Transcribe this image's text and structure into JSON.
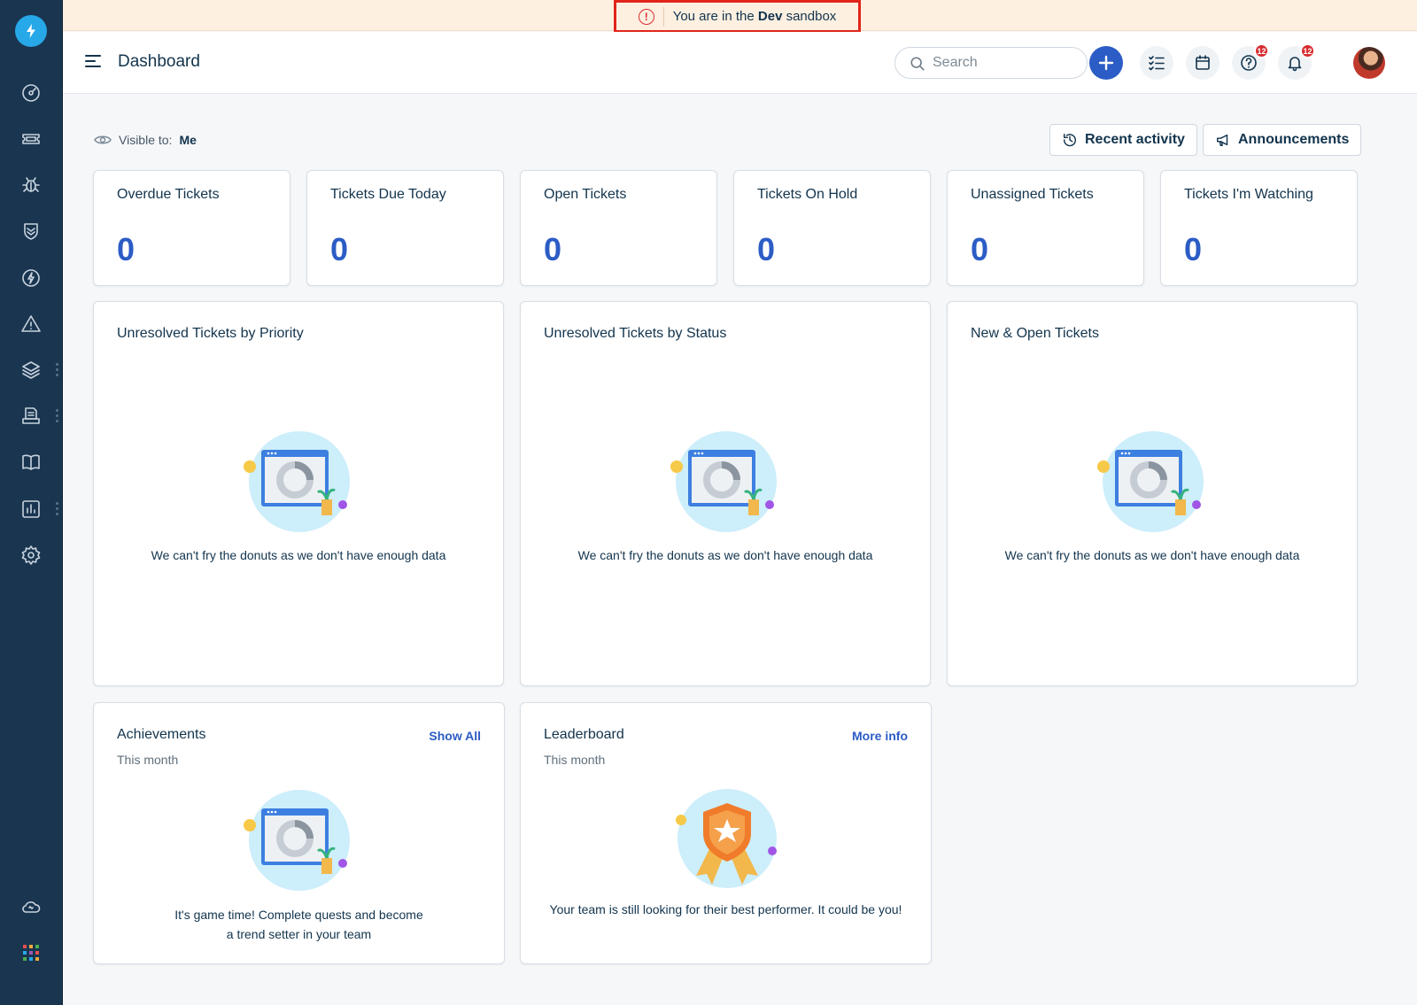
{
  "sandbox": {
    "prefix": "You are in the ",
    "env": "Dev",
    "suffix": " sandbox"
  },
  "header": {
    "title": "Dashboard",
    "search_placeholder": "Search",
    "help_badge": "12",
    "notifications_badge": "12"
  },
  "visibility": {
    "label": "Visible to:",
    "value": "Me"
  },
  "buttons": {
    "recent_activity": "Recent activity",
    "announcements": "Announcements"
  },
  "stats": [
    {
      "label": "Overdue Tickets",
      "value": "0"
    },
    {
      "label": "Tickets Due Today",
      "value": "0"
    },
    {
      "label": "Open Tickets",
      "value": "0"
    },
    {
      "label": "Tickets On Hold",
      "value": "0"
    },
    {
      "label": "Unassigned Tickets",
      "value": "0"
    },
    {
      "label": "Tickets I'm Watching",
      "value": "0"
    }
  ],
  "widgets": [
    {
      "title": "Unresolved Tickets by Priority",
      "empty": "We can't fry the donuts as we don't have enough data"
    },
    {
      "title": "Unresolved Tickets by Status",
      "empty": "We can't fry the donuts as we don't have enough data"
    },
    {
      "title": "New & Open Tickets",
      "empty": "We can't fry the donuts as we don't have enough data"
    }
  ],
  "achievements": {
    "title": "Achievements",
    "subtitle": "This month",
    "link": "Show All",
    "empty_line1": "It's game time! Complete quests and become",
    "empty_line2": "a trend setter in your team"
  },
  "leaderboard": {
    "title": "Leaderboard",
    "subtitle": "This month",
    "link": "More info",
    "empty": "Your team is still looking for their best performer. It could be you!"
  },
  "sidebar": {
    "items": [
      "dashboard-icon",
      "tickets-icon",
      "problems-icon",
      "changes-icon",
      "releases-icon",
      "alerts-icon",
      "assets-icon",
      "contracts-icon",
      "solutions-icon",
      "reports-icon",
      "admin-icon",
      "phone-cloud-icon",
      "apps-grid-icon"
    ]
  },
  "colors": {
    "sidebar": "#1a3550",
    "accent": "#2c5cc5",
    "sandbox_bg": "#fdf0e1",
    "sandbox_border": "#e1251b",
    "badge": "#d72d30"
  }
}
